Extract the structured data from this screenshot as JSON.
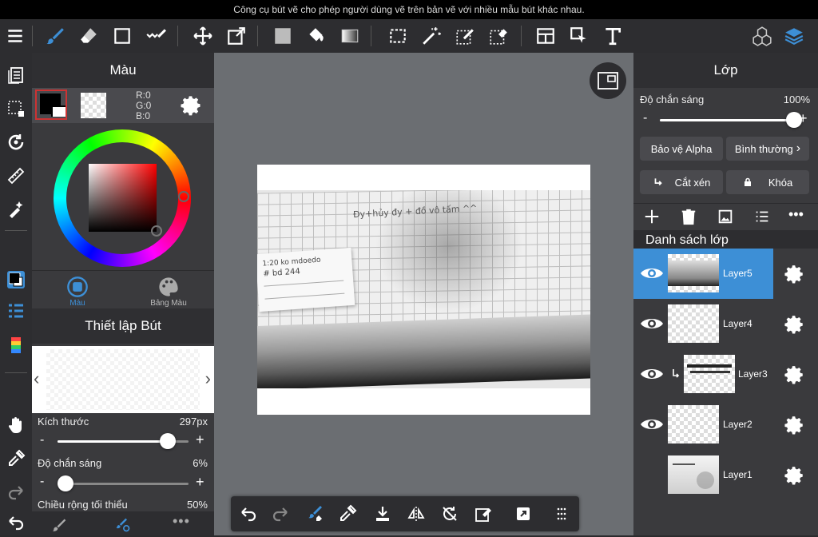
{
  "tooltip": "Công cụ bút vẽ cho phép người dùng vẽ trên bản vẽ với nhiều mẫu bút khác nhau.",
  "colors": {
    "accent": "#3d8fd6",
    "selected_layer": "#3d8fd6",
    "panel": "#3a3a3d"
  },
  "color_panel": {
    "title": "Màu",
    "rgb": {
      "r": "R:0",
      "g": "G:0",
      "b": "B:0"
    },
    "tabs": [
      {
        "label": "Màu",
        "active": true
      },
      {
        "label": "Bảng Màu",
        "active": false
      }
    ]
  },
  "brush_panel": {
    "title": "Thiết lập Bút",
    "size_label": "Kích thước",
    "size_value": "297px",
    "size_level": 0.84,
    "opacity_label": "Độ chắn sáng",
    "opacity_value": "6%",
    "opacity_level": 0.06,
    "minwidth_label": "Chiều rộng tối thiểu",
    "minwidth_value": "50%"
  },
  "layer_panel": {
    "title": "Lớp",
    "opacity_label": "Độ chắn sáng",
    "opacity_value": "100%",
    "opacity_level": 1.0,
    "alpha_label": "Bảo vệ Alpha",
    "blend_label": "Bình thường",
    "clip_label": "Cắt xén",
    "lock_label": "Khóa",
    "list_title": "Danh sách lớp",
    "layers": [
      {
        "name": "Layer5",
        "visible": true,
        "selected": true
      },
      {
        "name": "Layer4",
        "visible": true,
        "selected": false
      },
      {
        "name": "Layer3",
        "visible": true,
        "selected": false,
        "clipped": true
      },
      {
        "name": "Layer2",
        "visible": true,
        "selected": false
      },
      {
        "name": "Layer1",
        "visible": false,
        "selected": false
      }
    ]
  },
  "canvas": {
    "handwriting_1": "Đy+hủy đy + đồ vô tấm ^^",
    "note_1": "1:20 ko mdoedo",
    "note_2": "# bd 244"
  }
}
